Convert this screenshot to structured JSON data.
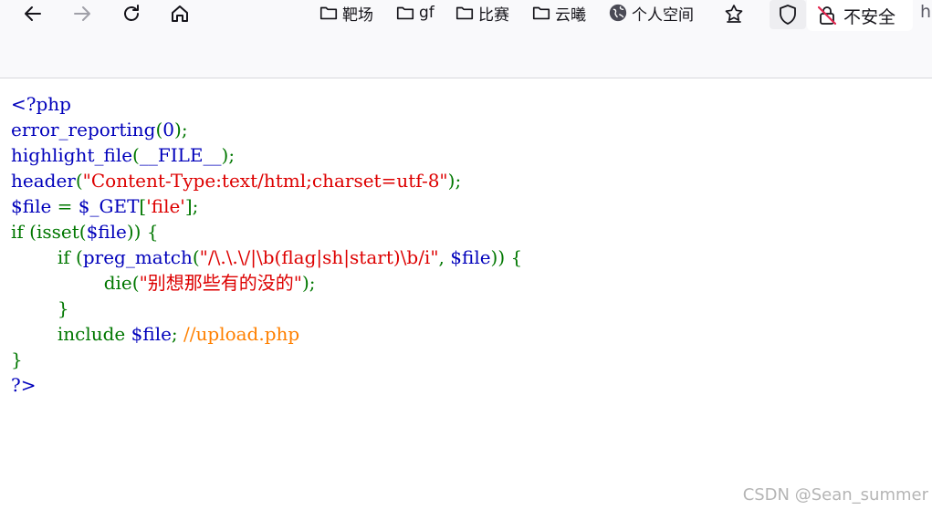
{
  "toolbar": {
    "bookmarks": [
      {
        "label": "靶场",
        "icon": "folder-icon"
      },
      {
        "label": "gf",
        "icon": "folder-icon"
      },
      {
        "label": "比赛",
        "icon": "folder-icon"
      },
      {
        "label": "云曦",
        "icon": "folder-icon"
      },
      {
        "label": "个人空间",
        "icon": "globe-icon"
      }
    ],
    "security_label": "不安全",
    "url_fragment": "h"
  },
  "code": {
    "lines": [
      [
        {
          "t": "<?php",
          "c": "default"
        }
      ],
      [
        {
          "t": "error_reporting",
          "c": "default"
        },
        {
          "t": "(",
          "c": "keyword"
        },
        {
          "t": "0",
          "c": "default"
        },
        {
          "t": ");",
          "c": "keyword"
        }
      ],
      [
        {
          "t": "highlight_file",
          "c": "default"
        },
        {
          "t": "(",
          "c": "keyword"
        },
        {
          "t": "__FILE__",
          "c": "default"
        },
        {
          "t": ");",
          "c": "keyword"
        }
      ],
      [
        {
          "t": "header",
          "c": "default"
        },
        {
          "t": "(",
          "c": "keyword"
        },
        {
          "t": "\"Content-Type:text/html;charset=utf-8\"",
          "c": "string"
        },
        {
          "t": ");",
          "c": "keyword"
        }
      ],
      [
        {
          "t": "$file ",
          "c": "default"
        },
        {
          "t": "= ",
          "c": "keyword"
        },
        {
          "t": "$_GET",
          "c": "default"
        },
        {
          "t": "[",
          "c": "keyword"
        },
        {
          "t": "'file'",
          "c": "string"
        },
        {
          "t": "];",
          "c": "keyword"
        }
      ],
      [
        {
          "t": "if ",
          "c": "keyword"
        },
        {
          "t": "(isset(",
          "c": "keyword"
        },
        {
          "t": "$file",
          "c": "default"
        },
        {
          "t": ")) ",
          "c": "keyword"
        },
        {
          "t": "{",
          "c": "keyword"
        }
      ],
      [
        {
          "t": "        if ",
          "c": "keyword"
        },
        {
          "t": "(",
          "c": "keyword"
        },
        {
          "t": "preg_match",
          "c": "default"
        },
        {
          "t": "(",
          "c": "keyword"
        },
        {
          "t": "\"/\\.\\.\\/|\\b(flag|sh|start)\\b/i\"",
          "c": "string"
        },
        {
          "t": ", ",
          "c": "keyword"
        },
        {
          "t": "$file",
          "c": "default"
        },
        {
          "t": ")) ",
          "c": "keyword"
        },
        {
          "t": "{",
          "c": "keyword"
        }
      ],
      [
        {
          "t": "                die(",
          "c": "keyword"
        },
        {
          "t": "\"别想那些有的没的\"",
          "c": "string"
        },
        {
          "t": ");",
          "c": "keyword"
        }
      ],
      [
        {
          "t": "        }",
          "c": "keyword"
        }
      ],
      [
        {
          "t": "        include ",
          "c": "keyword"
        },
        {
          "t": "$file",
          "c": "default"
        },
        {
          "t": "; ",
          "c": "keyword"
        },
        {
          "t": "//upload.php",
          "c": "comment"
        }
      ],
      [
        {
          "t": "}",
          "c": "keyword"
        }
      ],
      [
        {
          "t": "?>",
          "c": "default"
        }
      ]
    ]
  },
  "watermark": "CSDN @Sean_summer"
}
